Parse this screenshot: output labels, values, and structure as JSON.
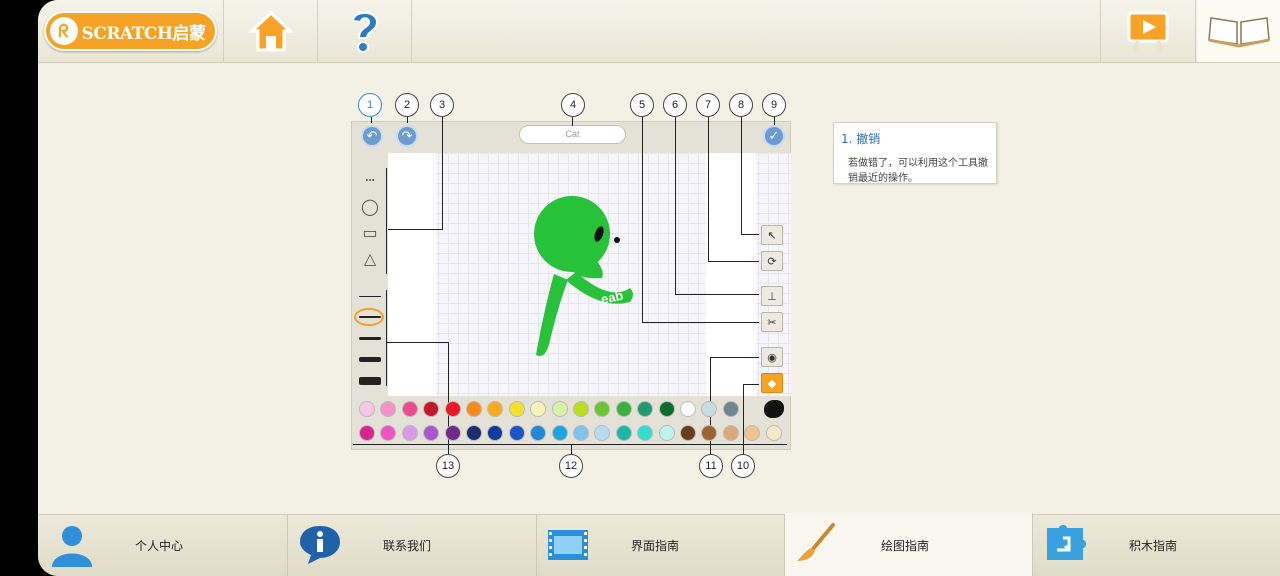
{
  "app": {
    "logo_text": "SCRATCH启蒙"
  },
  "topbar": {
    "home_icon": "home-icon",
    "help_icon": "question-mark-icon",
    "play_icon": "play-video-icon",
    "book_icon": "open-book-icon"
  },
  "steps": [
    "1",
    "2",
    "3",
    "4",
    "5",
    "6",
    "7",
    "8",
    "9",
    "10",
    "11",
    "12",
    "13"
  ],
  "editor": {
    "name_field": "Cat",
    "palette_row1": [
      "#f9c6e6",
      "#f792c8",
      "#ee4b8f",
      "#c5162b",
      "#e9182a",
      "#f78a1a",
      "#f8a91d",
      "#f3e22b",
      "#f7f2b8",
      "#d6f2a6",
      "#bcdd1e",
      "#6cc533",
      "#39b13c",
      "#1f9c6e",
      "#0d6e2c",
      "#ffffff",
      "#c9dbe3",
      "#6f8590"
    ],
    "palette_row2": [
      "#d8258d",
      "#ef55c2",
      "#d99be8",
      "#a858cc",
      "#6d2b8c",
      "#1c2e6e",
      "#103c9b",
      "#1c55c8",
      "#2388d8",
      "#1ea4e0",
      "#7ec4ef",
      "#b6dcf1",
      "#1eb6a7",
      "#2fe0d2",
      "#bff3ef",
      "#6a3e1c",
      "#9d6431",
      "#dca97f",
      "#f2c28f",
      "#f7e6c7"
    ]
  },
  "info": {
    "title": "1. 撤销",
    "body": "若做错了，可以利用这个工具撤销最近的操作。"
  },
  "bottom_nav": [
    {
      "label": "个人中心",
      "icon": "person-icon"
    },
    {
      "label": "联系我们",
      "icon": "info-icon"
    },
    {
      "label": "界面指南",
      "icon": "film-icon"
    },
    {
      "label": "绘图指南",
      "icon": "paintbrush-icon"
    },
    {
      "label": "积木指南",
      "icon": "puzzle-block-icon"
    }
  ]
}
